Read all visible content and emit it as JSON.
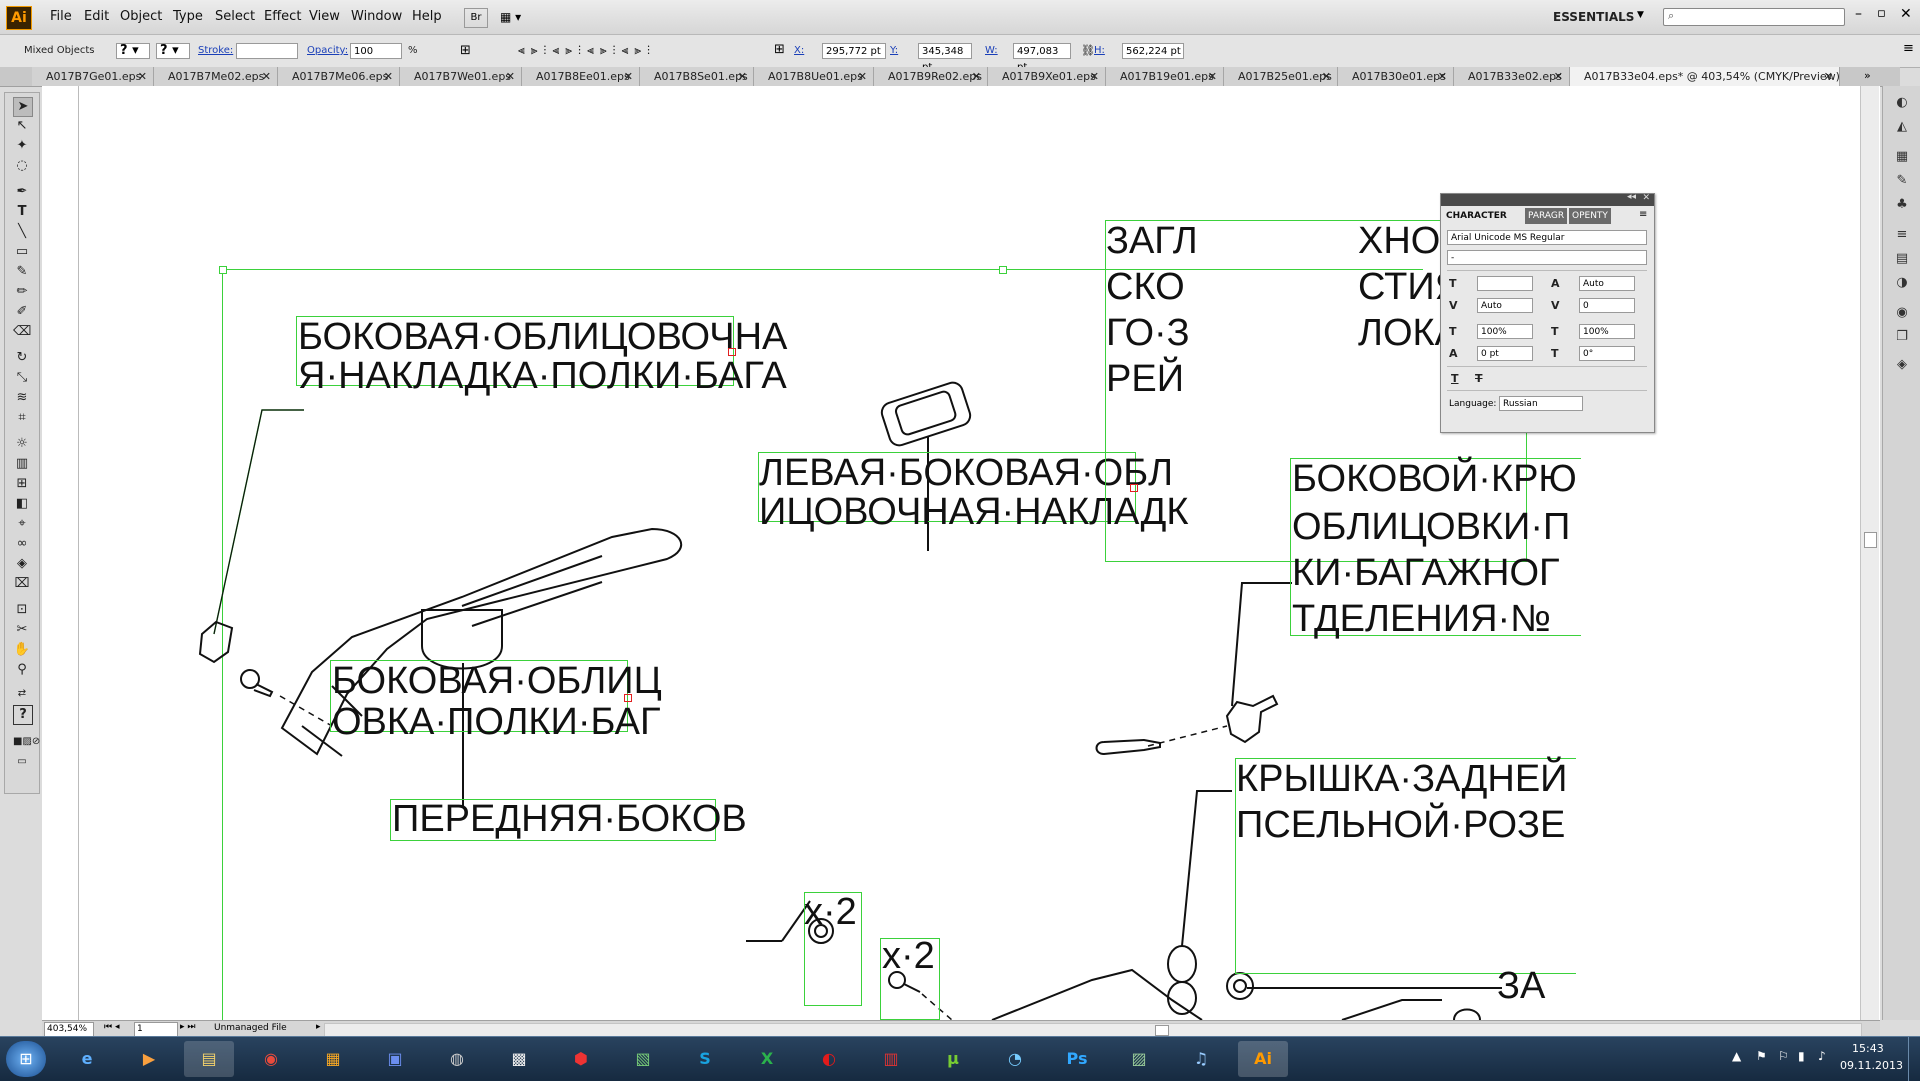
{
  "app": {
    "logo": "Ai"
  },
  "menu": [
    "File",
    "Edit",
    "Object",
    "Type",
    "Select",
    "Effect",
    "View",
    "Window",
    "Help"
  ],
  "workspace": {
    "name": "ESSENTIALS"
  },
  "control_bar": {
    "selection": "Mixed Objects",
    "stroke_label": "Stroke:",
    "opacity_label": "Opacity:",
    "opacity_value": "100",
    "opacity_unit": "%",
    "x_label": "X:",
    "x_value": "295,772 pt",
    "y_label": "Y:",
    "y_value": "345,348 pt",
    "w_label": "W:",
    "w_value": "497,083 pt",
    "h_label": "H:",
    "h_value": "562,224 pt"
  },
  "tabs": [
    "A017B7Ge01.eps",
    "A017B7Me02.eps",
    "A017B7Me06.eps",
    "A017B7We01.eps",
    "A017B8Ee01.eps",
    "A017B8Se01.eps",
    "A017B8Ue01.eps",
    "A017B9Re02.eps",
    "A017B9Xe01.eps",
    "A017B19e01.eps",
    "A017B25e01.eps",
    "A017B30e01.eps",
    "A017B33e02.eps",
    "A017B33e04.eps* @ 403,54% (CMYK/Preview)"
  ],
  "labels": {
    "l1_line1": "БОКОВАЯ·ОБЛИЦОВОЧНА",
    "l1_line2": "Я·НАКЛАДКА·ПОЛКИ·БАГА",
    "l2_line1": "ЛЕВАЯ·БОКОВАЯ·ОБЛ",
    "l2_line2": "ИЦОВОЧНАЯ·НАКЛАДК",
    "l3_line1": "БОКОВАЯ·ОБЛИЦ",
    "l3_line2": "ОВКА·ПОЛКИ·БАГ",
    "l4_line1": "ПЕРЕДНЯЯ·БОКОВ",
    "l5_line1": "ЗАГЛ",
    "l5_line1b": "ХНОЛОГИЧ",
    "l5_line2": "СКО",
    "l5_line2b": "СТИЯ·ЛЕВО",
    "l5_line3": "ГО·З",
    "l5_line3b": "ЛОКА·ФОНА",
    "l5_line4": "РЕЙ",
    "l6_line1": "БОКОВОЙ·КРЮ",
    "l6_line2": "ОБЛИЦОВКИ·П",
    "l6_line3": "КИ·БАГАЖНОГ",
    "l6_line4": "ТДЕЛЕНИЯ·№",
    "l7_line1": "КРЫШКА·ЗАДНЕЙ",
    "l7_line2": "ПСЕЛЬНОЙ·РОЗЕ",
    "l8_line1": "ЗА",
    "qty1": "x·2",
    "qty2": "x·2"
  },
  "character_panel": {
    "tab_character": "CHARACTER",
    "tab_paragraph": "PARAGR",
    "tab_opentype": "OPENTY",
    "font_family": "Arial Unicode MS Regular",
    "font_style": "-",
    "leading": "Auto",
    "kerning": "Auto",
    "tracking": "0",
    "vscale": "100%",
    "hscale": "100%",
    "baseline": "0 pt",
    "rotation": "0°",
    "language_label": "Language:",
    "language_value": "Russian"
  },
  "status": {
    "zoom": "403,54%",
    "artboard": "1",
    "file_state": "Unmanaged File"
  },
  "taskbar": {
    "time": "15:43",
    "date": "09.11.2013"
  }
}
